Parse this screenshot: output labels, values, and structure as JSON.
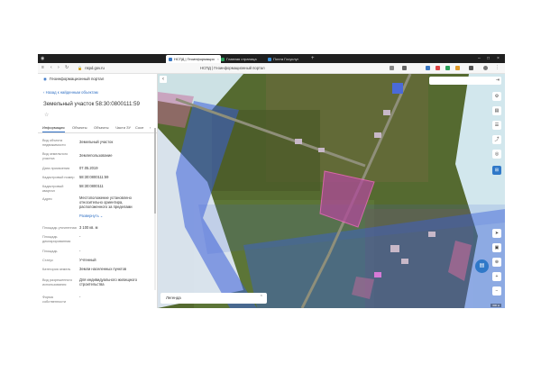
{
  "browser": {
    "tabs": [
      {
        "label": "НСПД | Геоинформацио",
        "active": true
      },
      {
        "label": "Главная страница",
        "active": false
      },
      {
        "label": "Почта Госуслуг",
        "active": false
      }
    ],
    "page_title": "НСПД | Геоинформационный портал",
    "url": "nspd.gov.ru"
  },
  "sidebar": {
    "header": "Геоинформационный портал",
    "back_link": "Назад к найденным объектам",
    "object_title": "Земельный участок 58:30:0800111:59",
    "tabs": [
      {
        "label": "Информация",
        "selected": true
      },
      {
        "label": "Объекты",
        "selected": false
      },
      {
        "label": "Объекты",
        "selected": false
      },
      {
        "label": "Части ЗУ",
        "selected": false
      },
      {
        "label": "Сосе",
        "selected": false
      }
    ],
    "properties": [
      {
        "label": "Вид объекта недвижимости",
        "value": "Земельный участок"
      },
      {
        "label": "Вид земельного участка",
        "value": "Землепользование"
      },
      {
        "label": "Дата присвоения",
        "value": "07.05.2019"
      },
      {
        "label": "Кадастровый номер",
        "value": "58:30:0800111:59"
      },
      {
        "label": "Кадастровый квартал",
        "value": "58:30:0800111"
      },
      {
        "label": "Адрес",
        "value": "Местоположение установлено относительно ориентира, расположенного за пределами",
        "link": "Развернуть"
      },
      {
        "label": "Площадь уточненная",
        "value": "3 100 кв. м"
      },
      {
        "label": "Площадь декларированная",
        "value": "-"
      },
      {
        "label": "Площадь",
        "value": "-"
      },
      {
        "label": "Статус",
        "value": "Учтенный"
      },
      {
        "label": "Категория земель",
        "value": "Земли населенных пунктов"
      },
      {
        "label": "Вид разрешенного использования",
        "value": "Для индивидуального жилищного строительства"
      },
      {
        "label": "Форма собственности",
        "value": "-"
      }
    ]
  },
  "map": {
    "legend_label": "Легенда",
    "scale_text": "300 м",
    "colors": {
      "parcel_highlight": "#b04a9a",
      "zone_blue": "#3a5fd8",
      "water_light": "#d9eef8"
    }
  }
}
